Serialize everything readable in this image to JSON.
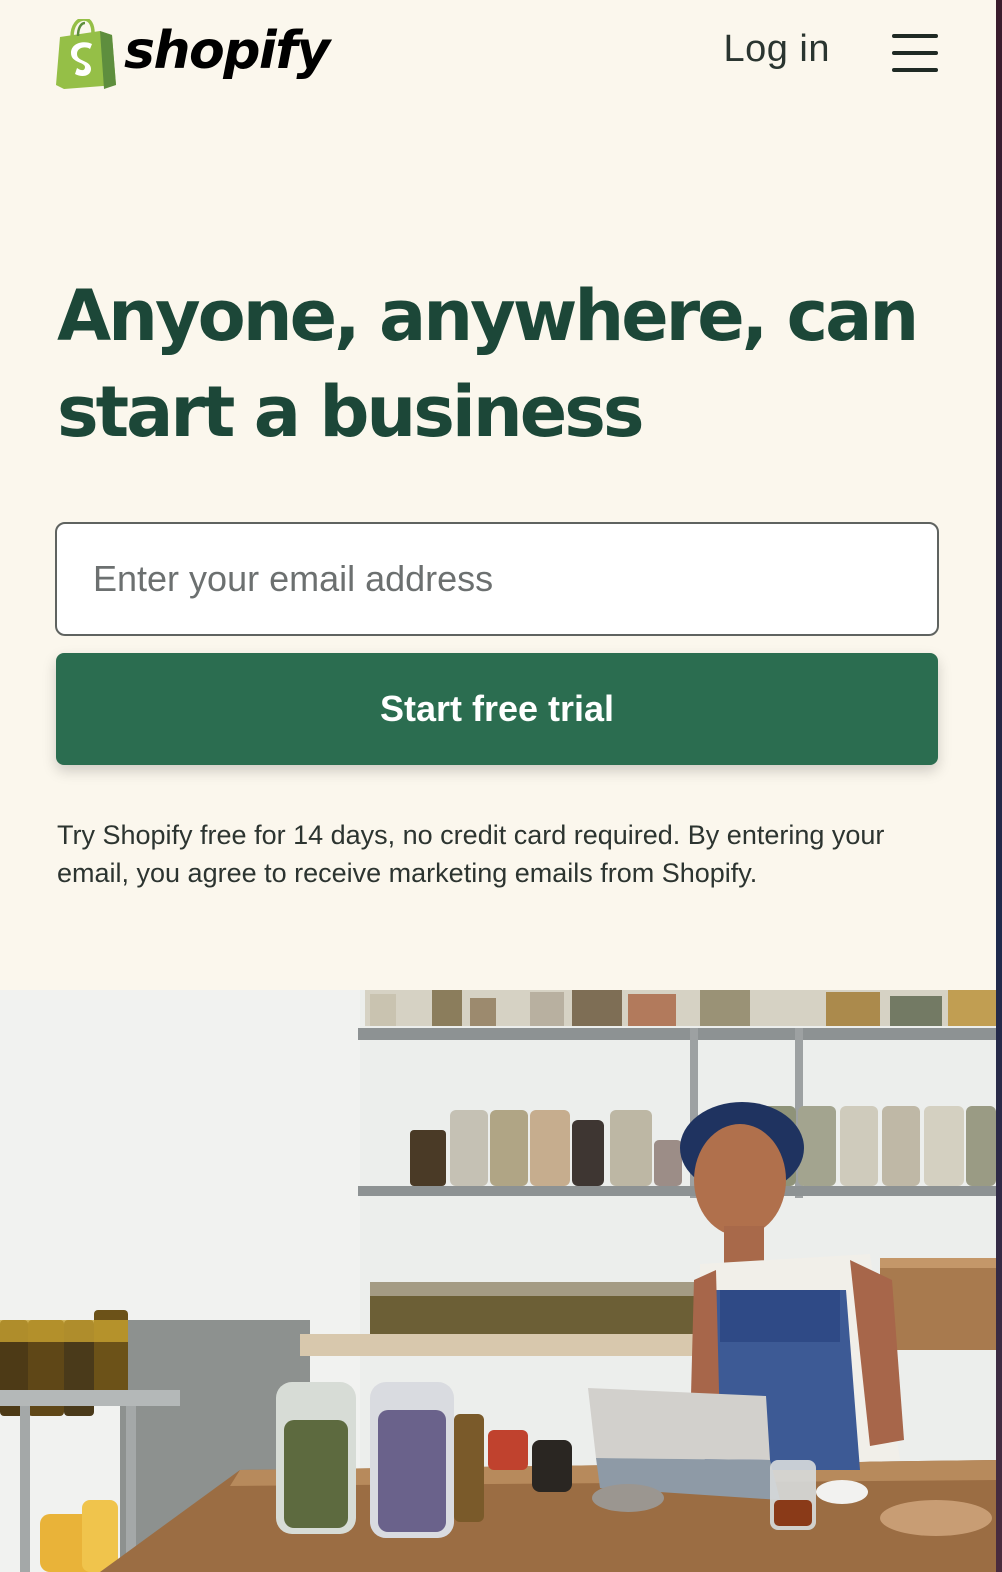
{
  "header": {
    "logo_text": "shopify",
    "logo_icon": "shopify-bag-icon",
    "login_label": "Log in",
    "menu_icon": "hamburger-menu-icon"
  },
  "hero": {
    "title": "Anyone, anywhere, can start a business",
    "email_placeholder": "Enter your email address",
    "email_value": "",
    "cta_label": "Start free trial",
    "disclaimer": "Try Shopify free for 14 days, no credit card required. By entering your email, you agree to receive marketing emails from Shopify."
  },
  "photo": {
    "description_icon": "merchant-photo"
  },
  "colors": {
    "background": "#fbf7ed",
    "heading": "#1c4738",
    "button": "#2b6d50",
    "logo_green": "#95bf47"
  }
}
